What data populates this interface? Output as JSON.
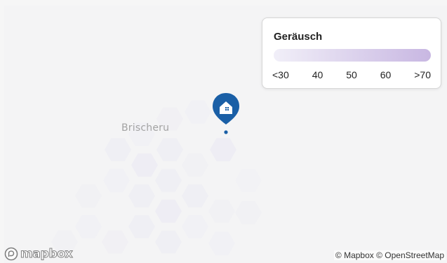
{
  "map": {
    "place_label": "Brischeru",
    "marker_icon": "house-icon",
    "marker_color": "#1a5fa6",
    "hex_fill": "#e6e4f3"
  },
  "legend": {
    "title": "Geräusch",
    "gradient_start": "#f1eff8",
    "gradient_end": "#c8b7e2",
    "ticks": [
      "<30",
      "40",
      "50",
      "60",
      ">70"
    ]
  },
  "footer": {
    "logo_text": "mapbox",
    "attribution": "© Mapbox © OpenStreetMap"
  }
}
